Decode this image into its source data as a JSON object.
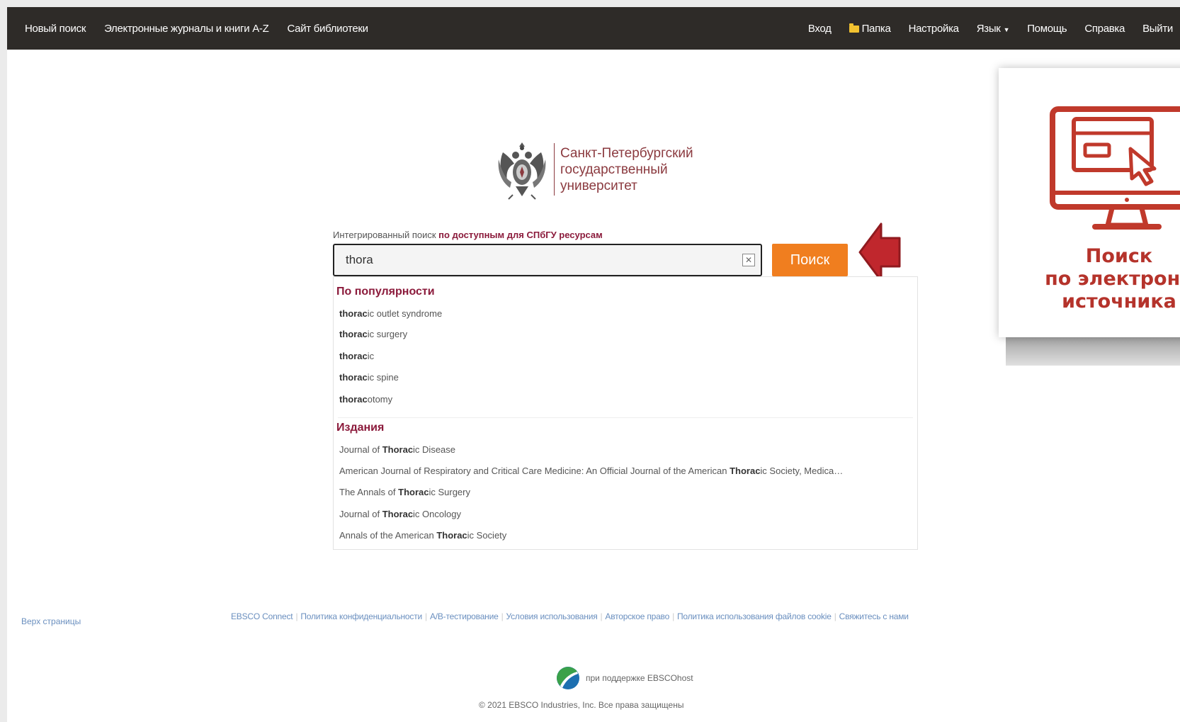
{
  "nav": {
    "left": [
      "Новый поиск",
      "Электронные журналы и книги A-Z",
      "Сайт библиотеки"
    ],
    "login": "Вход",
    "folder": "Папка",
    "settings": "Настройка",
    "language": "Язык",
    "help": "Помощь",
    "reference": "Справка",
    "logout": "Выйти"
  },
  "logo": {
    "line1": "Санкт-Петербургский",
    "line2": "государственный",
    "line3": "университет"
  },
  "search": {
    "label_plain": "Интегрированный поиск ",
    "label_bold": "по доступным для СПбГУ ресурсам",
    "value": "thora",
    "button": "Поиск"
  },
  "dropdown": {
    "popular_heading": "По популярности",
    "popular": [
      {
        "prefix": "thorac",
        "rest": "ic outlet syndrome"
      },
      {
        "prefix": "thorac",
        "rest": "ic surgery"
      },
      {
        "prefix": "thorac",
        "rest": "ic"
      },
      {
        "prefix": "thorac",
        "rest": "ic spine"
      },
      {
        "prefix": "thorac",
        "rest": "otomy"
      }
    ],
    "publications_heading": "Издания",
    "publications": [
      {
        "pre": "Journal of ",
        "bold": "Thorac",
        "post": "ic Disease"
      },
      {
        "pre": "American Journal of Respiratory and Critical Care Medicine: An Official Journal of the American ",
        "bold": "Thorac",
        "post": "ic Society, Medica…"
      },
      {
        "pre": "The Annals of ",
        "bold": "Thorac",
        "post": "ic Surgery"
      },
      {
        "pre": "Journal of ",
        "bold": "Thorac",
        "post": "ic Oncology"
      },
      {
        "pre": "Annals of the American ",
        "bold": "Thorac",
        "post": "ic Society"
      }
    ]
  },
  "promo": {
    "line1": "Поиск",
    "line2": "по электронн",
    "line3": "источника"
  },
  "footer": {
    "back_to_top": "Верх страницы",
    "links": [
      "EBSCO Connect",
      "Политика конфиденциальности",
      "A/B-тестирование",
      "Условия использования",
      "Авторское право",
      "Политика использования файлов cookie",
      "Свяжитесь с нами"
    ],
    "powered": "при поддержке EBSCOhost",
    "copyright": "© 2021 EBSCO Industries, Inc. Все права защищены"
  },
  "colors": {
    "nav_bg": "#2e2b28",
    "accent_orange": "#f07e1f",
    "heading_maroon": "#8b1a3b",
    "promo_red": "#b5332b",
    "arrow_red": "#c0272d"
  }
}
